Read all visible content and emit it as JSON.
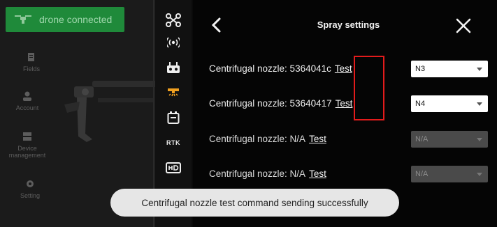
{
  "status": {
    "text": "drone connected"
  },
  "nav": {
    "items": [
      {
        "label": "Fields",
        "icon": "fields-icon"
      },
      {
        "label": "Account",
        "icon": "account-icon"
      },
      {
        "label": "Device\nmanagement",
        "icon": "device-icon"
      },
      {
        "label": "Setting",
        "icon": "gear-icon"
      }
    ]
  },
  "toolbar": {
    "tools": [
      {
        "icon": "drone-icon"
      },
      {
        "icon": "signal-icon"
      },
      {
        "icon": "remote-controller-icon"
      },
      {
        "icon": "spray-icon"
      },
      {
        "icon": "battery-icon"
      },
      {
        "icon": "rtk-icon",
        "label": "RTK"
      },
      {
        "icon": "hd-video-icon"
      }
    ]
  },
  "panel": {
    "title": "Spray settings",
    "rows": [
      {
        "label": "Centrifugal nozzle: 5364041c",
        "test": "Test",
        "selected": "N3",
        "enabled": true
      },
      {
        "label": "Centrifugal nozzle: 53640417",
        "test": "Test",
        "selected": "N4",
        "enabled": true
      },
      {
        "label": "Centrifugal nozzle: N/A",
        "test": "Test",
        "selected": "N/A",
        "enabled": false
      },
      {
        "label": "Centrifugal nozzle: N/A",
        "test": "Test",
        "selected": "N/A",
        "enabled": false
      }
    ]
  },
  "toast": {
    "text": "Centrifugal nozzle test command sending successfully"
  },
  "colors": {
    "status_green": "#1f8a3a",
    "highlight_red": "#e31b1b",
    "panel_bg": "#050505"
  }
}
